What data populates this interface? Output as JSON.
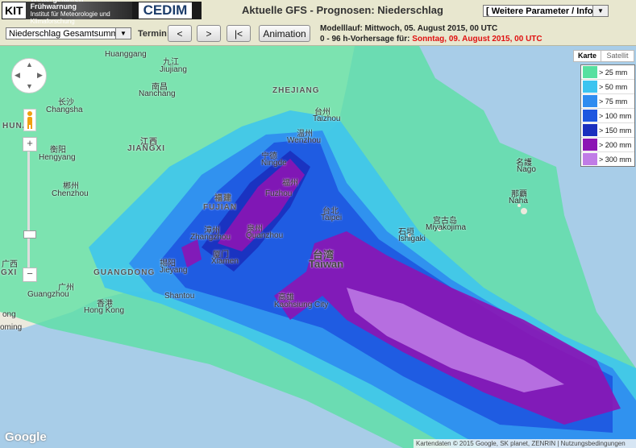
{
  "header": {
    "logo_kit": "KIT",
    "logo_wfw_title": "Wettergefahren-Frühwarnung",
    "logo_wfw_sub": "Institut für Meteorologie und Klimaforschung",
    "logo_cedim": "CEDIM",
    "title": "Aktuelle GFS - Prognosen: Niederschlag",
    "param_select": "[ Weitere Parameter / Info ]"
  },
  "toolbar": {
    "product_select": "Niederschlag Gesamtsumme",
    "termin_label": "Termin:",
    "prev_label": "<",
    "next_label": ">",
    "first_label": "|<",
    "animation_label": "Animation",
    "run_line": "Modelllauf: Mittwoch, 05. August 2015, 00 UTC",
    "forecast_prefix": "0 - 96 h-Vorhersage für:",
    "forecast_date": "Sonntag, 09. August 2015, 00 UTC"
  },
  "map": {
    "type_map": "Karte",
    "type_satellite": "Satellit",
    "attribution": "Kartendaten © 2015 Google, SK planet, ZENRIN  |  Nutzungsbedingungen",
    "google": "Google",
    "zoom_in": "+",
    "zoom_out": "−",
    "labels": [
      "Huanggang",
      "九江",
      "Jiujiang",
      "Nanchang",
      "南昌",
      "Changsha",
      "长沙",
      "HUNAN",
      "江西",
      "JIANGXI",
      "衡阳",
      "Hengyang",
      "郴州",
      "Chenzhou",
      "福建",
      "FUJIAN",
      "漳州",
      "Zhangzhou",
      "泉州",
      "Quanzhou",
      "厦门",
      "Xiamen",
      "揭阳",
      "Jieyang",
      "Shantou",
      "GUANGDONG",
      "广州",
      "Guangzhou",
      "香港",
      "Hong Kong",
      "高雄",
      "Kaohsiung City",
      "Taiwan",
      "台湾",
      "台北",
      "Taipei",
      "宁德",
      "Ningde",
      "福州",
      "Fuzhou",
      "温州",
      "Wenzhou",
      "台州",
      "Taizhou",
      "ZHEJIANG",
      "宫古岛",
      "Miyakojima",
      "石垣",
      "Ishigaki",
      "名護",
      "Nago",
      "那覇",
      "Naha",
      "GXI",
      "ong",
      "oming",
      "广西"
    ]
  },
  "legend": [
    {
      "label": "> 25 mm",
      "color": "#57e0a0"
    },
    {
      "label": "> 50 mm",
      "color": "#3cc4f0"
    },
    {
      "label": "> 75 mm",
      "color": "#2f8cf0"
    },
    {
      "label": "> 100 mm",
      "color": "#1e56e0"
    },
    {
      "label": "> 150 mm",
      "color": "#1a2fbe"
    },
    {
      "label": "> 200 mm",
      "color": "#8c14b4"
    },
    {
      "label": "> 300 mm",
      "color": "#c07ce6"
    }
  ]
}
